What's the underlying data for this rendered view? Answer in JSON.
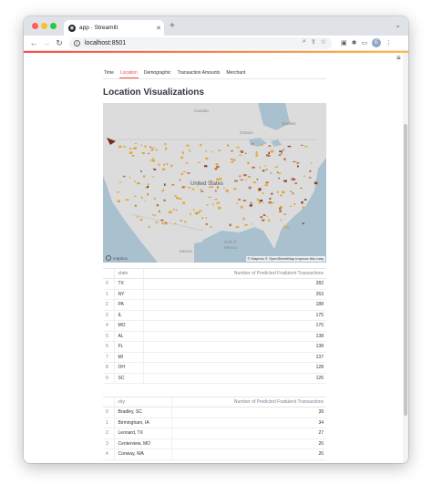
{
  "browser": {
    "tab_title": "app · Streamlit",
    "tab_favicon": "◉",
    "tab_close": "✕",
    "new_tab": "+",
    "tabbar_chevron": "⌄",
    "back": "←",
    "forward": "→",
    "reload": "↻",
    "info": "i",
    "url": "localhost:8501",
    "omnibox_icons": [
      "⌕",
      "⇪",
      "☆"
    ],
    "toolbar_icons": [
      "▣",
      "✱",
      "▭"
    ],
    "avatar": "E",
    "menu": "⋮"
  },
  "app": {
    "hamburger": "≡",
    "tabs": [
      {
        "label": "Time",
        "active": false
      },
      {
        "label": "Location",
        "active": true
      },
      {
        "label": "Demographic",
        "active": false
      },
      {
        "label": "Transaction Amounts",
        "active": false
      },
      {
        "label": "Merchant",
        "active": false
      }
    ],
    "heading": "Location Visualizations",
    "map": {
      "labels": {
        "canada": "Canada",
        "united_states": "United States",
        "mexico": "Mexico",
        "gulf": "Gulf of",
        "gulf2": "Mexico",
        "ontario": "Ontario",
        "quebec": "Quebec"
      },
      "attribution": "© Mapbox © OpenStreetMap  Improve this map",
      "logo": "mapbox",
      "colors": {
        "water": "#a9c0cf",
        "land": "#dcdcdc",
        "hotspot_low": "#e0a020",
        "hotspot_mid": "#c0602a",
        "hotspot_high": "#7a2a1a"
      }
    },
    "state_table": {
      "columns": [
        "",
        "state",
        "Number of Predicted Fradulent Transactions"
      ],
      "rows": [
        [
          "0",
          "TX",
          "282"
        ],
        [
          "1",
          "NY",
          "263"
        ],
        [
          "2",
          "PA",
          "188"
        ],
        [
          "3",
          "IL",
          "175"
        ],
        [
          "4",
          "MO",
          "170"
        ],
        [
          "5",
          "AL",
          "138"
        ],
        [
          "6",
          "FL",
          "138"
        ],
        [
          "7",
          "MI",
          "137"
        ],
        [
          "8",
          "OH",
          "128"
        ],
        [
          "9",
          "SC",
          "126"
        ]
      ]
    },
    "city_table": {
      "columns": [
        "",
        "city",
        "Number of Predicted Fradulent Transactions"
      ],
      "rows": [
        [
          "0",
          "Bradley, SC",
          "39"
        ],
        [
          "1",
          "Birmingham, IA",
          "34"
        ],
        [
          "2",
          "Leonard, TX",
          "27"
        ],
        [
          "3",
          "Centerview, MO",
          "26"
        ],
        [
          "4",
          "Conway, WA",
          "26"
        ]
      ]
    }
  }
}
